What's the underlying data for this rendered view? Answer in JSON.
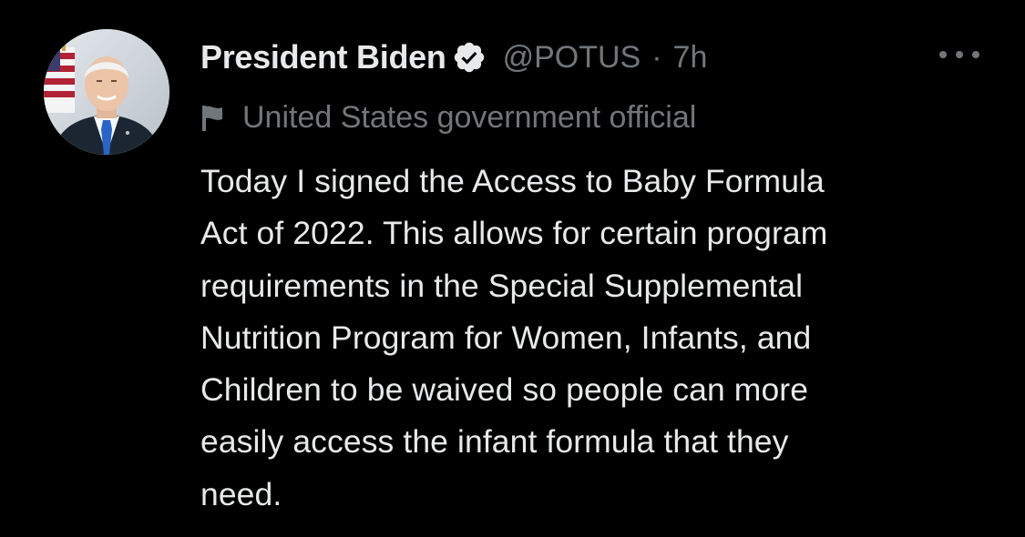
{
  "tweet": {
    "author": {
      "display_name": "President Biden",
      "handle": "@POTUS",
      "verified_icon": "verified-badge-icon",
      "avatar_icon": "avatar"
    },
    "separator": "·",
    "time": "7h",
    "more_icon": "more-options-icon",
    "label": {
      "icon": "flag-icon",
      "text": "United States government official"
    },
    "text": "Today I signed the Access to Baby Formula\nAct of 2022. This allows for certain program\nrequirements in the Special Supplemental\nNutrition Program for Women, Infants, and\nChildren to be waived so people can more\neasily access the infant formula that they\nneed."
  },
  "colors": {
    "background": "#000000",
    "primary_text": "#e7e9ea",
    "secondary_text": "#71767b",
    "badge_fill": "#e7e9ea",
    "badge_check": "#000000"
  }
}
